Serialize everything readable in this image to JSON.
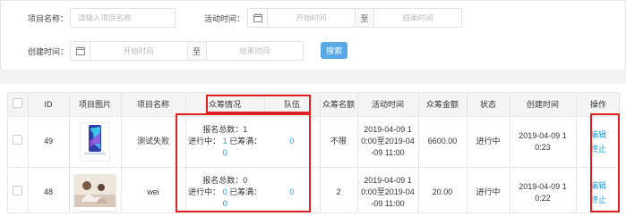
{
  "filters": {
    "project_name_label": "项目名称：",
    "project_name_placeholder": "请输入项目名称",
    "activity_time_label": "活动时间：",
    "activity_start_placeholder": "开始时间",
    "activity_to": "至",
    "activity_end_placeholder": "结束时间",
    "create_time_label": "创建时间：",
    "create_start_placeholder": "开始时间",
    "create_to": "至",
    "create_end_placeholder": "结束时间",
    "search_button": "搜索"
  },
  "table": {
    "headers": [
      "ID",
      "项目图片",
      "项目名称",
      "众筹情况",
      "队伍",
      "众筹名额",
      "活动时间",
      "众筹金额",
      "状态",
      "创建时间",
      "操作"
    ],
    "rows": [
      {
        "id": "49",
        "name": "测试失败",
        "signup_total_label": "报名总数：",
        "signup_total": "1",
        "in_progress_label": "进行中：",
        "in_progress": "1",
        "full_label": "已筹满：",
        "full": "0",
        "team": "0",
        "quota": "不限",
        "activity_time": "2019-04-09 10:00至2019-04-09 11:00",
        "amount": "6600.00",
        "status": "进行中",
        "created": "2019-04-09 10:23",
        "edit": "编辑",
        "stop": "终止"
      },
      {
        "id": "48",
        "name": "wei",
        "signup_total_label": "报名总数：",
        "signup_total": "0",
        "in_progress_label": "进行中：",
        "in_progress": "0",
        "full_label": "已筹满：",
        "full": "0",
        "team": "0",
        "quota": "2",
        "activity_time": "2019-04-09 10:00至2019-04-09 11:00",
        "amount": "20.00",
        "status": "进行中",
        "created": "2019-04-09 10:22",
        "edit": "编辑",
        "stop": "终止"
      }
    ]
  },
  "colors": {
    "accent": "#1e9ed9",
    "button": "#5aa9e6",
    "highlight": "#e02020"
  }
}
